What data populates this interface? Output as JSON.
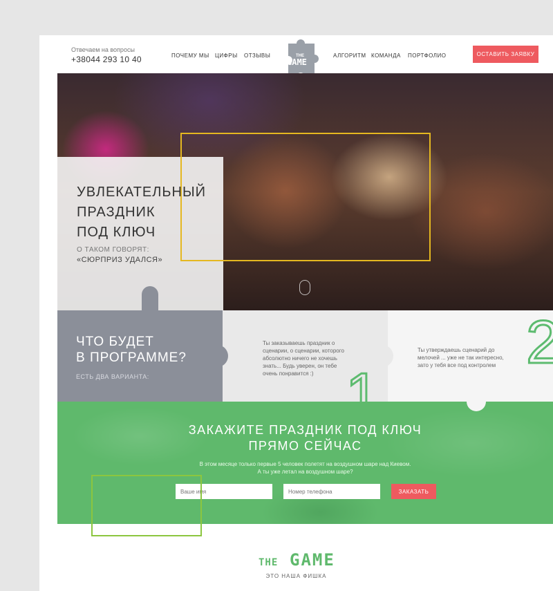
{
  "header": {
    "questions_label": "Отвечаем на вопросы",
    "phone": "+38044 293 10 40",
    "nav": [
      {
        "label": "ПОЧЕМУ МЫ"
      },
      {
        "label": "ЦИФРЫ"
      },
      {
        "label": "ОТЗЫВЫ"
      },
      {
        "label": "АЛГОРИТМ"
      },
      {
        "label": "КОМАНДА"
      },
      {
        "label": "ПОРТФОЛИО"
      }
    ],
    "logo_small": "THE",
    "logo_big": "GAME",
    "cta_label": "ОСТАВИТЬ ЗАЯВКУ"
  },
  "hero": {
    "title_lines": [
      "УВЛЕКАТЕЛЬНЫЙ",
      "ПРАЗДНИК",
      "ПОД КЛЮЧ"
    ],
    "subtitle": "О ТАКОМ ГОВОРЯТ:",
    "quote": "«СЮРПРИЗ УДАЛСЯ»"
  },
  "program": {
    "title_lines": [
      "ЧТО БУДЕТ",
      "В ПРОГРАММЕ?"
    ],
    "subtitle": "ЕСТЬ ДВА ВАРИАНТА:",
    "option1": {
      "number": "1",
      "lines": [
        "Ты заказываешь праздник о",
        "сценарии, о сценарии, которого",
        "абсолютно ничего не хочешь",
        "знать... Будь уверен, он тебе",
        "очень понравится :)"
      ]
    },
    "option2": {
      "number": "2",
      "lines": [
        "Ты утверждаешь сценарий до",
        "мелочей ... уже не так интересно,",
        "зато у тебя все под контролем"
      ]
    }
  },
  "order": {
    "title_lines": [
      "ЗАКАЖИТЕ ПРАЗДНИК ПОД КЛЮЧ",
      "ПРЯМО СЕЙЧАС"
    ],
    "text_lines": [
      "В этом месяце только первые 5 человек полетят на воздушном шаре над Киевом.",
      "А ты уже летал на воздушном шаре?"
    ],
    "name_placeholder": "Ваше имя",
    "phone_placeholder": "Номер телефона",
    "button_label": "ЗАКАЗАТЬ"
  },
  "brand": {
    "the": "THE",
    "game": "GAME",
    "tagline": "ЭТО НАША ФИШКА"
  },
  "colors": {
    "accent_red": "#ee5a5f",
    "accent_green": "#5fb96c",
    "frame_yellow": "#e5b820",
    "frame_lime": "#8cc63f",
    "panel_gray": "#8b8f99"
  }
}
